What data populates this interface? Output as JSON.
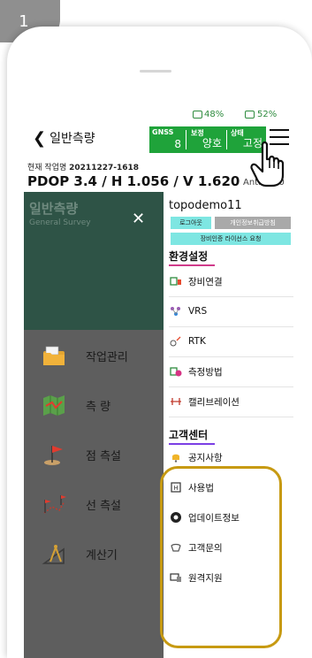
{
  "step_number": "1",
  "status": {
    "signal": "48%",
    "battery": "52%"
  },
  "header": {
    "back_label": "일반측량",
    "gnss": {
      "label": "GNSS",
      "value": "8",
      "correction_label": "보정",
      "correction_value": "양호",
      "state_label": "상태",
      "state_value": "고정"
    }
  },
  "work": {
    "label": "현재 작업명",
    "name": "20211227-1618"
  },
  "precision": {
    "text": "PDOP 3.4 / H 1.056 / V 1.620",
    "ant": "Ant.H 0.0"
  },
  "drawer_header": {
    "title": "일반측량",
    "subtitle": "General Survey"
  },
  "menu": [
    {
      "label": "작업관리",
      "icon": "folder-icon"
    },
    {
      "label": "측 량",
      "icon": "map-icon"
    },
    {
      "label": "점 측설",
      "icon": "flag-icon"
    },
    {
      "label": "선 측설",
      "icon": "route-flag-icon"
    },
    {
      "label": "계산기",
      "icon": "compass-calculator-icon"
    }
  ],
  "account": {
    "username": "topodemo11",
    "logout_label": "로그아웃",
    "privacy_label": "개인정보취급방침",
    "license_label": "장비인증 라이선스 요청"
  },
  "settings": {
    "title": "환경설정",
    "items": [
      {
        "label": "장비연결",
        "icon": "device-connect-icon"
      },
      {
        "label": "VRS",
        "icon": "vrs-icon"
      },
      {
        "label": "RTK",
        "icon": "rtk-icon"
      },
      {
        "label": "측정방법",
        "icon": "measure-method-icon"
      },
      {
        "label": "캘리브레이션",
        "icon": "calibration-icon"
      }
    ]
  },
  "support": {
    "title": "고객센터",
    "items": [
      {
        "label": "공지사항",
        "icon": "bell-icon"
      },
      {
        "label": "사용법",
        "icon": "manual-icon"
      },
      {
        "label": "업데이트정보",
        "icon": "update-icon"
      },
      {
        "label": "고객문의",
        "icon": "inquiry-icon"
      },
      {
        "label": "원격지원",
        "icon": "remote-support-icon"
      }
    ]
  },
  "colors": {
    "gnss": "#1fa33a",
    "highlight": "#c79a12",
    "drawer_head": "#2e5346",
    "license_btn": "#7ee6e2",
    "logout_btn": "#7ee6e2"
  }
}
